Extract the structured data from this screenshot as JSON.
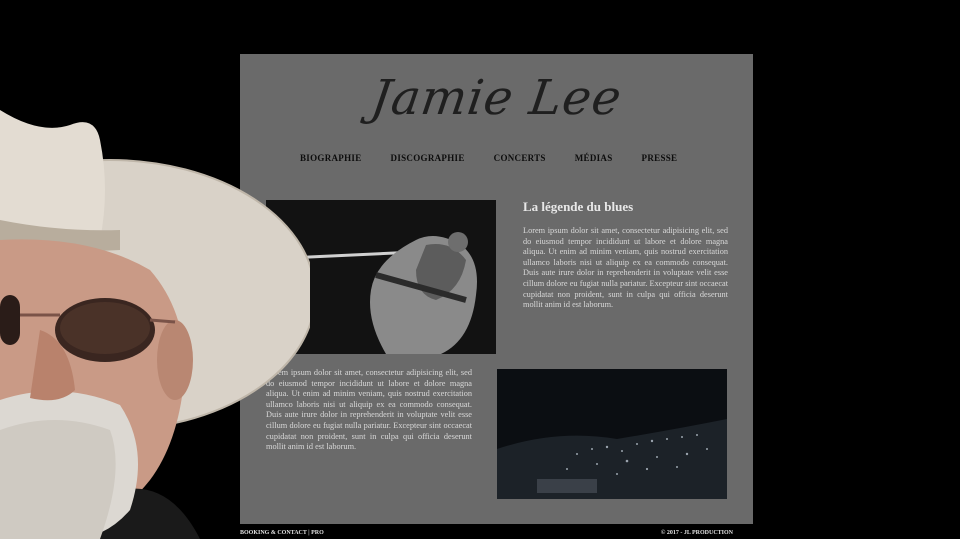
{
  "site": {
    "logo": "Jamie Lee"
  },
  "nav": [
    {
      "label": "BIOGRAPHIE"
    },
    {
      "label": "DISCOGRAPHIE"
    },
    {
      "label": "CONCERTS"
    },
    {
      "label": "MÉDIAS"
    },
    {
      "label": "PRESSE"
    }
  ],
  "section": {
    "heading": "La légende du blues",
    "paragraph1": "Lorem ipsum dolor sit amet, consectetur adipisicing elit, sed do eiusmod tempor incididunt ut labore et dolore magna aliqua. Ut enim ad minim veniam, quis nostrud exercitation ullamco laboris nisi ut aliquip ex ea commodo consequat. Duis aute irure dolor in reprehenderit in voluptate velit esse cillum dolore eu fugiat nulla pariatur. Excepteur sint occaecat cupidatat non proident, sunt in culpa qui officia deserunt mollit anim id est laborum.",
    "paragraph2": "Lorem ipsum dolor sit amet, consectetur adipisicing elit, sed do eiusmod tempor incididunt ut labore et dolore magna aliqua. Ut enim ad minim veniam, quis nostrud exercitation ullamco laboris nisi ut aliquip ex ea commodo consequat. Duis aute irure dolor in reprehenderit in voluptate velit esse cillum dolore eu fugiat nulla pariatur. Excepteur sint occaecat cupidatat non proident, sunt in culpa qui officia deserunt mollit anim id est laborum."
  },
  "footer": {
    "left_link": "BOOKING & CONTACT",
    "separator": "|",
    "left_link2": "PRO",
    "right": "© 2017 - JL PRODUCTION"
  },
  "colors": {
    "background": "#000000",
    "panel": "#6a6a6a",
    "nav_text": "#0d0d0d"
  }
}
